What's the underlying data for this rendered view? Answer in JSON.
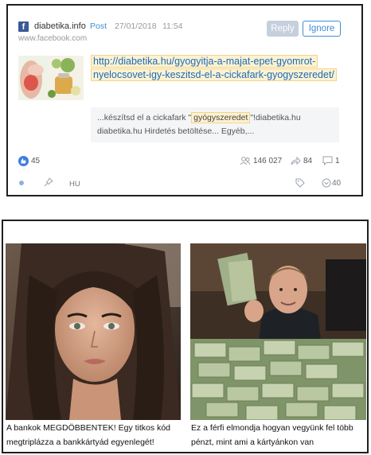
{
  "post": {
    "source_icon": "facebook-icon",
    "source_letter": "f",
    "source_name": "diabetika.info",
    "source_url": "www.facebook.com",
    "type": "Post",
    "date": "27/01/2018",
    "time": "11:54",
    "reply_label": "Reply",
    "ignore_label": "Ignore",
    "link": "http://diabetika.hu/gyogyitja-a-majat-epet-gyomrot-nyelocsovet-igy-keszitsd-el-a-cickafark-gyogyszeredet/",
    "snippet_before": "...készítsd el a cickafark \"",
    "snippet_highlight": "gyógyszeredet",
    "snippet_after": "\"!diabetika.hu diabetika.hu Hirdetés betöltése... Egyéb,...",
    "likes": "45",
    "reach": "146 027",
    "shares": "84",
    "comments": "1",
    "language": "HU",
    "score": "40"
  },
  "ads": [
    {
      "caption": "A bankok MEGDÖBBENTEK! Egy titkos kód megtriplázza a bankkártyád egyenlegét!"
    },
    {
      "caption": "Ez a férfi elmondja hogyan vegyünk fel több pénzt, mint ami a kártyánkon van"
    }
  ],
  "colors": {
    "accent": "#3d8fd9",
    "link": "#1a6bbd",
    "highlight": "#fdf2d0",
    "facebook": "#3b5998"
  }
}
